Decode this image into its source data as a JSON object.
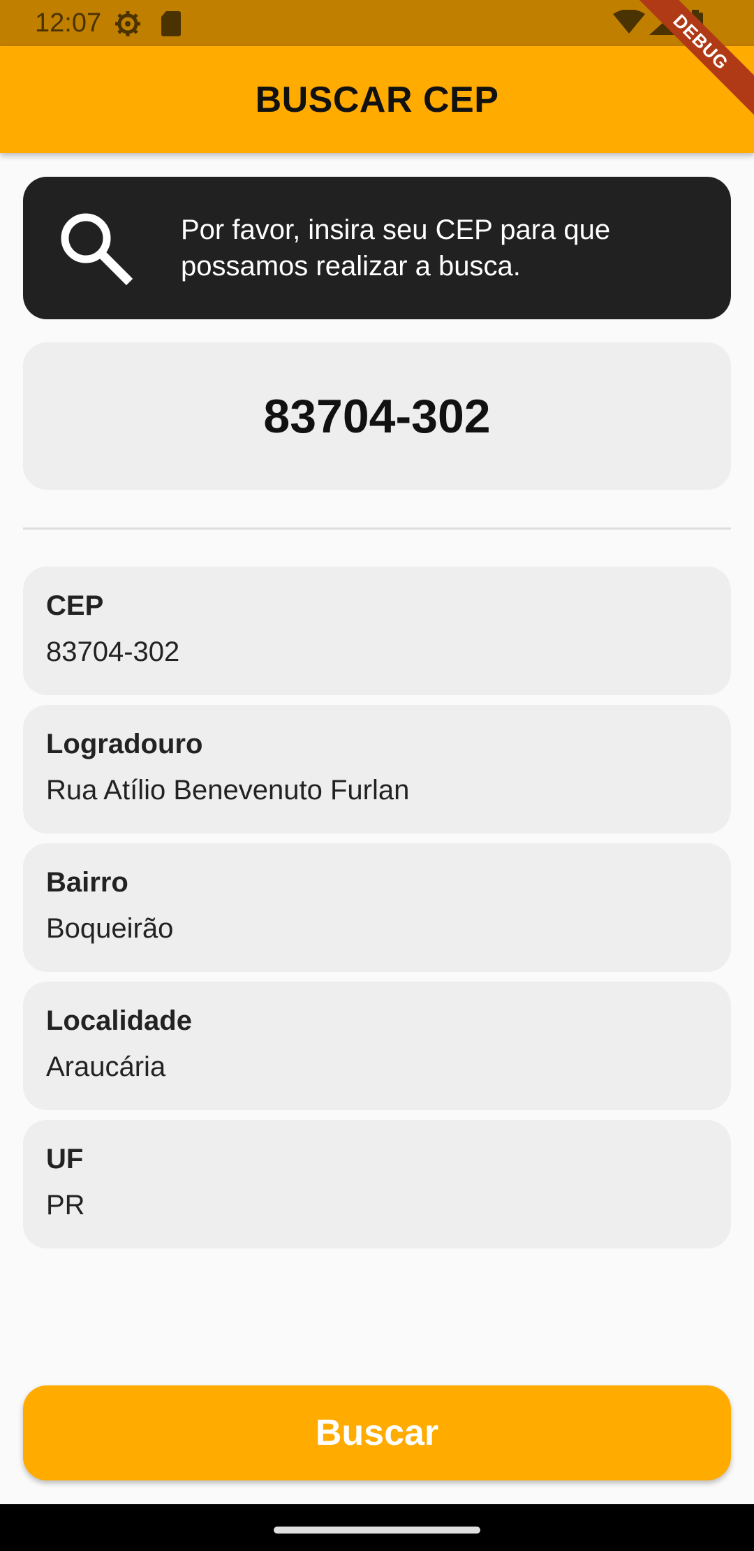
{
  "status_bar": {
    "time": "12:07",
    "icons": [
      "settings-icon",
      "sd-card-icon",
      "wifi-icon",
      "signal-icon",
      "battery-icon"
    ]
  },
  "app_bar": {
    "title": "BUSCAR CEP",
    "debug_banner": "DEBUG"
  },
  "info_card": {
    "icon": "search-icon",
    "message": "Por favor, insira seu CEP para que possamos realizar a busca."
  },
  "cep_input": {
    "value": "83704-302"
  },
  "results": [
    {
      "label": "CEP",
      "value": "83704-302"
    },
    {
      "label": "Logradouro",
      "value": "Rua Atílio Benevenuto Furlan"
    },
    {
      "label": "Bairro",
      "value": "Boqueirão"
    },
    {
      "label": "Localidade",
      "value": "Araucária"
    },
    {
      "label": "UF",
      "value": "PR"
    }
  ],
  "search_button": {
    "label": "Buscar"
  },
  "colors": {
    "accent": "#ffab00",
    "status_bar": "#c17f00",
    "info_card": "#212121",
    "field_background": "#eeeeee",
    "debug_banner": "#b03a16"
  }
}
